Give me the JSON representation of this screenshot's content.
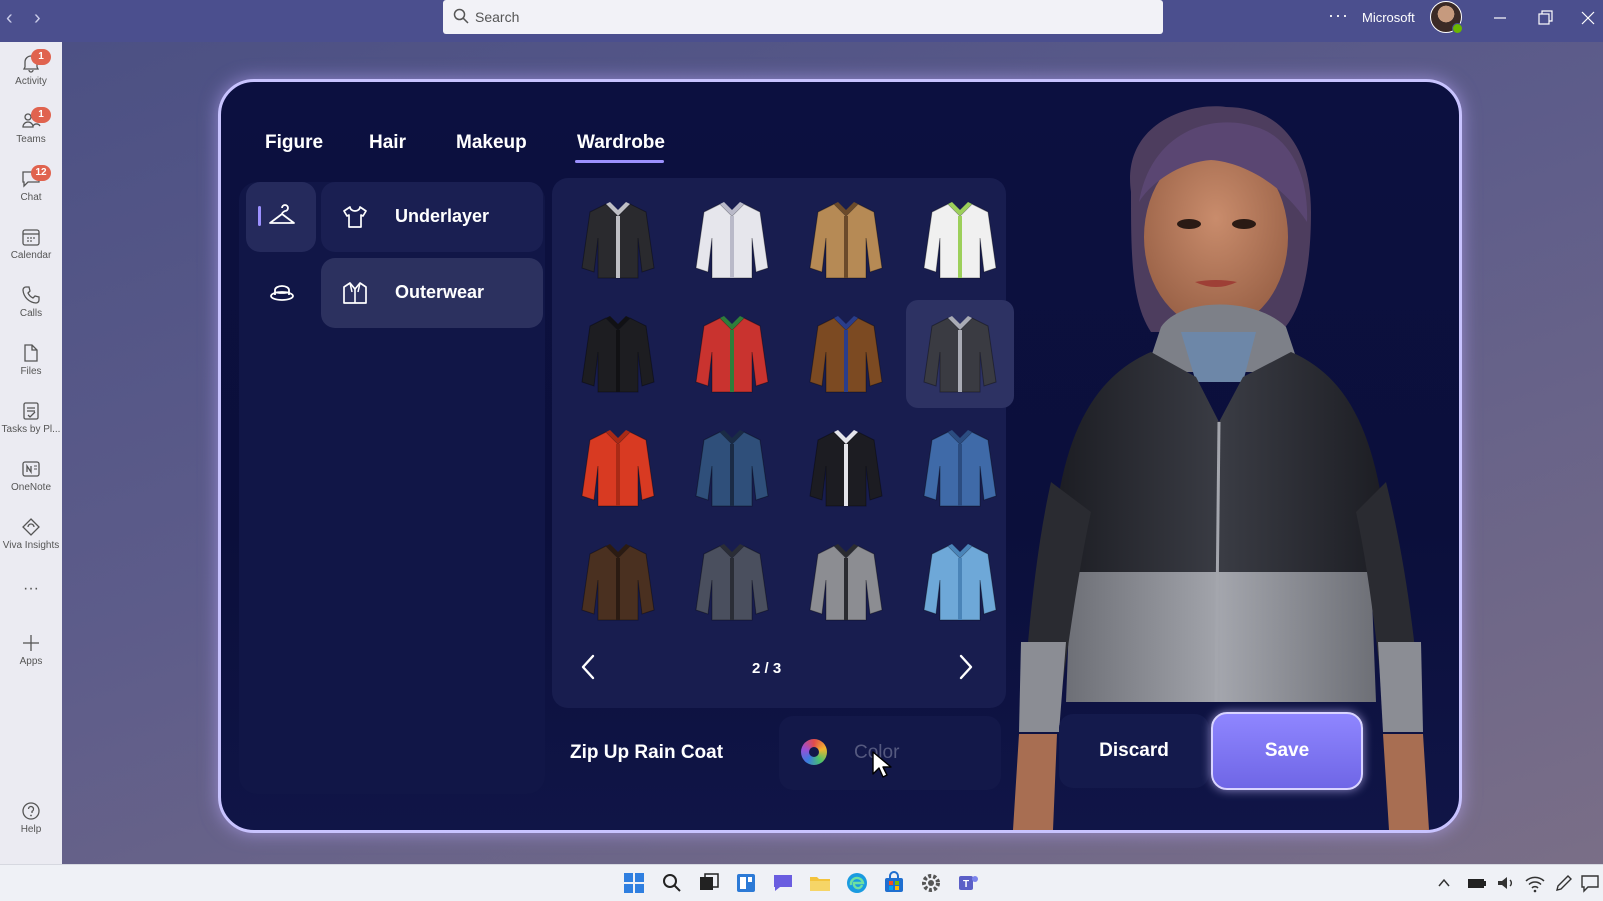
{
  "titlebar": {
    "search_placeholder": "Search",
    "more": "···",
    "org": "Microsoft"
  },
  "rail": [
    {
      "label": "Activity",
      "icon": "bell-icon",
      "badge": "1"
    },
    {
      "label": "Teams",
      "icon": "teams-icon",
      "badge": "1"
    },
    {
      "label": "Chat",
      "icon": "chat-icon",
      "badge": "12"
    },
    {
      "label": "Calendar",
      "icon": "calendar-icon",
      "badge": ""
    },
    {
      "label": "Calls",
      "icon": "phone-icon",
      "badge": ""
    },
    {
      "label": "Files",
      "icon": "file-icon",
      "badge": ""
    },
    {
      "label": "Tasks by Pl...",
      "icon": "tasks-icon",
      "badge": ""
    },
    {
      "label": "OneNote",
      "icon": "onenote-icon",
      "badge": ""
    },
    {
      "label": "Viva Insights",
      "icon": "insights-icon",
      "badge": ""
    },
    {
      "label": "···",
      "icon": "more-icon",
      "badge": ""
    },
    {
      "label": "Apps",
      "icon": "plus-icon",
      "badge": ""
    },
    {
      "label": "Help",
      "icon": "help-icon",
      "badge": ""
    }
  ],
  "tabs": [
    "Figure",
    "Hair",
    "Makeup",
    "Wardrobe"
  ],
  "selected_tab": "Wardrobe",
  "subcategories": [
    "Underlayer",
    "Outerwear"
  ],
  "selected_subcategory": "Outerwear",
  "garments": [
    {
      "color": "#2a2a2e",
      "trim": "#bfbfc4"
    },
    {
      "color": "#e6e6ec",
      "trim": "#b9b9c8"
    },
    {
      "color": "#b68a55",
      "trim": "#6b4a2a"
    },
    {
      "color": "#f0f0f0",
      "trim": "#9ccf5a"
    },
    {
      "color": "#1d1d21",
      "trim": "#111114"
    },
    {
      "color": "#c9332f",
      "trim": "#2f7d3a"
    },
    {
      "color": "#7c4a22",
      "trim": "#2a3d8a"
    },
    {
      "color": "#3a3b42",
      "trim": "#a9abb4"
    },
    {
      "color": "#d83a22",
      "trim": "#a92a16"
    },
    {
      "color": "#2f4f7a",
      "trim": "#1a2b45"
    },
    {
      "color": "#1c1c22",
      "trim": "#e4e4ea"
    },
    {
      "color": "#3f6aa8",
      "trim": "#2b4c80"
    },
    {
      "color": "#4a3020",
      "trim": "#2b1b12"
    },
    {
      "color": "#4a4f5e",
      "trim": "#2a2d36"
    },
    {
      "color": "#8c8d92",
      "trim": "#2a2b30"
    },
    {
      "color": "#6ea8d8",
      "trim": "#4a84b8"
    }
  ],
  "selected_garment_index": 7,
  "pager": {
    "text": "2 / 3",
    "current": 2,
    "total": 3
  },
  "selected_item_name": "Zip Up Rain Coat",
  "color_label": "Color",
  "discard_label": "Discard",
  "save_label": "Save",
  "colors": {
    "accent": "#9c91ff",
    "panel": "#0c1040",
    "save": "#7a71f0"
  }
}
